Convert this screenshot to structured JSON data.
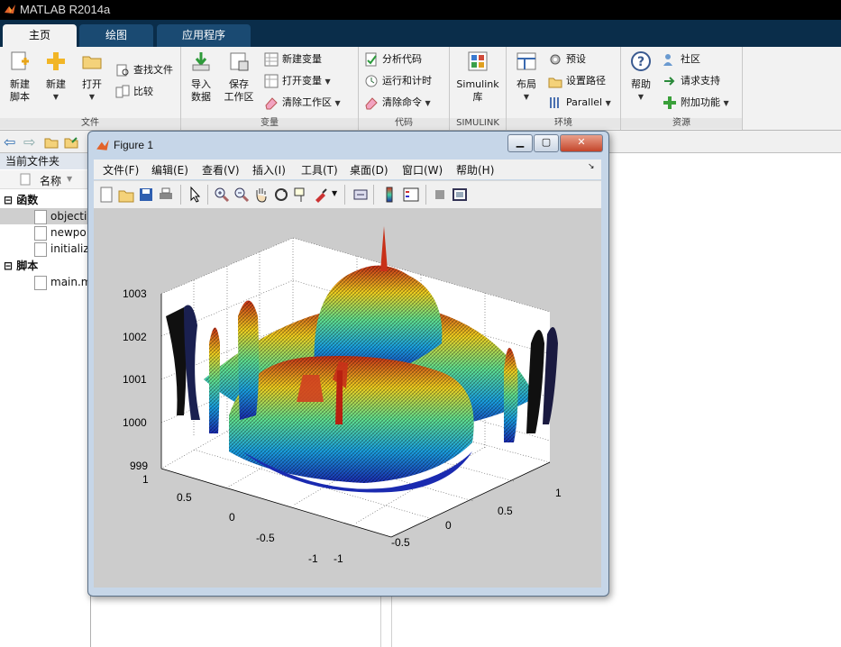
{
  "app": {
    "title": "MATLAB R2014a"
  },
  "tabs": [
    {
      "label": "主页"
    },
    {
      "label": "绘图"
    },
    {
      "label": "应用程序"
    }
  ],
  "ribbon": {
    "file_group": {
      "label": "文件",
      "new_script": "新建\n脚本",
      "new": "新建",
      "open": "打开",
      "find_files": "查找文件",
      "compare": "比较"
    },
    "variable_group": {
      "label": "变量",
      "import": "导入\n数据",
      "save_workspace": "保存\n工作区",
      "new_variable": "新建变量",
      "open_variable": "打开变量",
      "clear_workspace": "清除工作区"
    },
    "code_group": {
      "label": "代码",
      "analyze": "分析代码",
      "run_time": "运行和计时",
      "clear_commands": "清除命令"
    },
    "simulink_group": {
      "label": "SIMULINK",
      "simulink": "Simulink\n库"
    },
    "env_group": {
      "label": "环境",
      "layout": "布局",
      "preferences": "预设",
      "set_path": "设置路径",
      "parallel": "Parallel"
    },
    "resources_group": {
      "label": "资源",
      "help": "帮助",
      "community": "社区",
      "request_support": "请求支持",
      "addons": "附加功能"
    }
  },
  "left_panel": {
    "header": "当前文件夹",
    "column": "名称",
    "sections": [
      {
        "label": "函数",
        "items": [
          "objectiv",
          "newpo",
          "initializ"
        ]
      },
      {
        "label": "脚本",
        "items": [
          "main.m"
        ]
      }
    ]
  },
  "figure": {
    "title": "Figure 1",
    "menu": [
      "文件(F)",
      "编辑(E)",
      "查看(V)",
      "插入(I)",
      "工具(T)",
      "桌面(D)",
      "窗口(W)",
      "帮助(H)"
    ],
    "zticks": [
      "1003",
      "1002",
      "1001",
      "1000",
      "999"
    ],
    "yticks": [
      "1",
      "0.5",
      "0",
      "-0.5",
      "-1"
    ],
    "xticks": [
      "-1",
      "-0.5",
      "0",
      "0.5",
      "1"
    ]
  },
  "colors": {
    "ribbon_tabs_bg": "#0a2d4a",
    "titlebar_bg": "#000000",
    "figure_frame": "#c6d6e8",
    "plot_bg": "#cccccc"
  }
}
